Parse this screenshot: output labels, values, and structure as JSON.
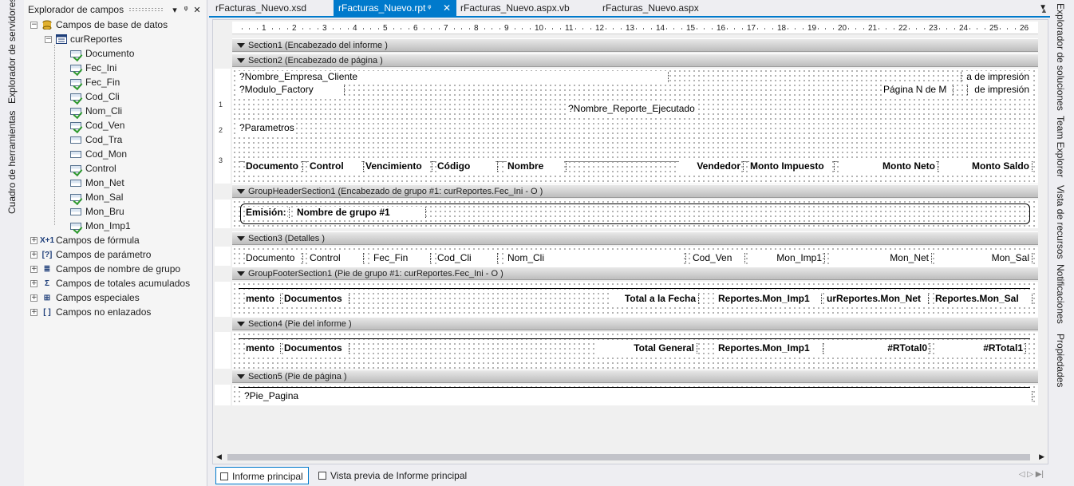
{
  "left_side_tabs": [
    "Explorador de servidores",
    "Cuadro de herramientas"
  ],
  "right_side_tabs": [
    "Explorador de soluciones",
    "Team Explorer",
    "Vista de recursos",
    "Notificaciones",
    "Propiedades"
  ],
  "explorer": {
    "title": "Explorador de campos",
    "pin_glyph": "ᵠ",
    "tree": {
      "root": "Campos de base de datos",
      "table": "curReportes",
      "fields": [
        "Documento",
        "Fec_Ini",
        "Fec_Fin",
        "Cod_Cli",
        "Nom_Cli",
        "Cod_Ven",
        "Cod_Tra",
        "Cod_Mon",
        "Control",
        "Mon_Net",
        "Mon_Sal",
        "Mon_Bru",
        "Mon_Imp1"
      ],
      "field_used": [
        true,
        true,
        true,
        true,
        true,
        true,
        false,
        false,
        true,
        false,
        true,
        false,
        true
      ],
      "groups": [
        {
          "label": "Campos de fórmula",
          "icon": "formula-icon",
          "glyph": "X+1"
        },
        {
          "label": "Campos de parámetro",
          "icon": "parameter-icon",
          "glyph": "[?]"
        },
        {
          "label": "Campos de nombre de grupo",
          "icon": "group-name-icon",
          "glyph": "≣"
        },
        {
          "label": "Campos de totales acumulados",
          "icon": "running-total-icon",
          "glyph": "Σ"
        },
        {
          "label": "Campos especiales",
          "icon": "special-field-icon",
          "glyph": "⊞"
        },
        {
          "label": "Campos no enlazados",
          "icon": "unbound-field-icon",
          "glyph": "[ ]"
        }
      ]
    }
  },
  "tabs": [
    {
      "label": "rFacturas_Nuevo.xsd",
      "active": false
    },
    {
      "label": "rFacturas_Nuevo.rpt",
      "active": true
    },
    {
      "label": "rFacturas_Nuevo.aspx.vb",
      "active": false
    },
    {
      "label": "rFacturas_Nuevo.aspx",
      "active": false
    }
  ],
  "ruler": [
    "1",
    "2",
    "3",
    "4",
    "5",
    "6",
    "7",
    "8",
    "9",
    "10",
    "11",
    "12",
    "13",
    "14",
    "15",
    "16",
    "17",
    "18",
    "19",
    "20",
    "21",
    "22",
    "23",
    "24",
    "25",
    "26"
  ],
  "vruler_marks": [
    "1",
    "2",
    "3"
  ],
  "sections": {
    "s1": "Section1 (Encabezado del informe  )",
    "s2": "Section2 (Encabezado de página  )",
    "gh": "GroupHeaderSection1 (Encabezado de grupo #1: curReportes.Fec_Ini - O )",
    "s3": "Section3 (Detalles  )",
    "gf": "GroupFooterSection1 (Pie de grupo #1: curReportes.Fec_Ini - O )",
    "s4": "Section4 (Pie del informe  )",
    "s5": "Section5 (Pie de página  )"
  },
  "page_header": {
    "empresa": "?Nombre_Empresa_Cliente",
    "modulo": "?Modulo_Factory",
    "fecha_impresion": "a de impresión",
    "pagina": "Página N de M",
    "hora_impresion": "de impresión",
    "reporte": "?Nombre_Reporte_Ejecutado",
    "parametros": "?Parametros",
    "columns": [
      "Documento",
      "Control",
      "Vencimiento",
      "Código",
      "Nombre",
      "Vendedor",
      "Monto Impuesto",
      "Monto Neto",
      "Monto Saldo"
    ]
  },
  "group_header": {
    "label": "Emisión:",
    "value": "Nombre de grupo #1"
  },
  "details": [
    "Documento",
    "Control",
    "Fec_Fin",
    "Cod_Cli",
    "Nom_Cli",
    "Cod_Ven",
    "Mon_Imp1",
    "Mon_Net",
    "Mon_Sal"
  ],
  "group_footer": [
    "mento",
    "Documentos",
    "Total a la Fecha",
    "Reportes.Mon_Imp1",
    "urReportes.Mon_Net",
    "Reportes.Mon_Sal"
  ],
  "report_footer": [
    "mento",
    "Documentos",
    "Total General",
    "Reportes.Mon_Imp1",
    "#RTotal0",
    "#RTotal1"
  ],
  "page_footer": {
    "pie": "?Pie_Pagina"
  },
  "bottom_tabs": [
    {
      "label": "Informe principal",
      "active": true
    },
    {
      "label": "Vista previa de Informe principal",
      "active": false
    }
  ]
}
